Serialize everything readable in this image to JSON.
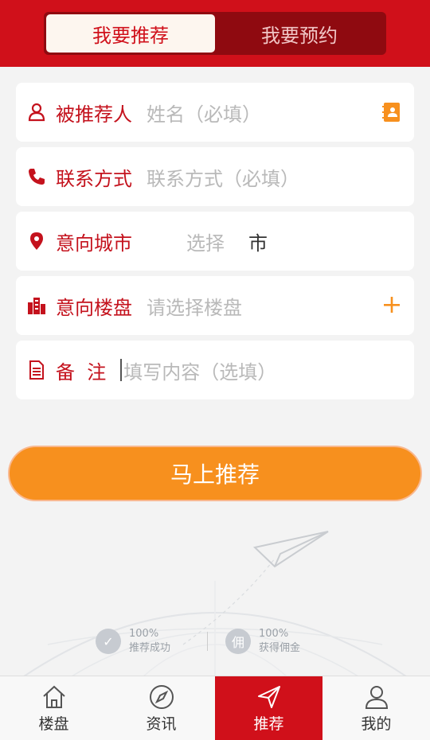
{
  "header": {
    "tabs": [
      {
        "label": "我要推荐",
        "active": true
      },
      {
        "label": "我要预约",
        "active": false
      }
    ]
  },
  "form": {
    "name": {
      "label": "被推荐人",
      "placeholder": "姓名（必填）",
      "icon": "person-icon",
      "right_icon": "contacts-book-icon"
    },
    "phone": {
      "label": "联系方式",
      "placeholder": "联系方式（必填）",
      "icon": "phone-icon"
    },
    "city": {
      "label": "意向城市",
      "placeholder": "选择",
      "suffix": "市",
      "icon": "location-pin-icon"
    },
    "estate": {
      "label": "意向楼盘",
      "placeholder": "请选择楼盘",
      "icon": "building-icon",
      "right_icon": "plus-icon"
    },
    "notes": {
      "label": "备  注",
      "placeholder": "填写内容（选填）",
      "icon": "document-icon"
    }
  },
  "submit": {
    "label": "马上推荐"
  },
  "badges": [
    {
      "value": "100%",
      "label": "推荐成功",
      "icon": "check-icon"
    },
    {
      "value": "100%",
      "label": "获得佣金",
      "icon": "commission-icon",
      "glyph": "佣"
    }
  ],
  "nav": {
    "items": [
      {
        "label": "楼盘",
        "icon": "home-icon",
        "active": false
      },
      {
        "label": "资讯",
        "icon": "compass-icon",
        "active": false
      },
      {
        "label": "推荐",
        "icon": "paper-plane-icon",
        "active": true
      },
      {
        "label": "我的",
        "icon": "user-icon",
        "active": false
      }
    ]
  },
  "colors": {
    "brand_red": "#d0101a",
    "accent_orange": "#f7901e",
    "label_red": "#c4121d"
  }
}
